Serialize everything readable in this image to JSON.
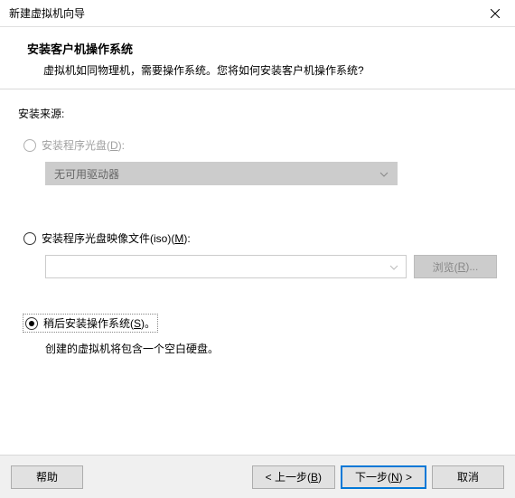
{
  "window": {
    "title": "新建虚拟机向导"
  },
  "header": {
    "title": "安装客户机操作系统",
    "desc": "虚拟机如同物理机，需要操作系统。您将如何安装客户机操作系统?"
  },
  "source_label": "安装来源:",
  "options": {
    "disc": {
      "label_pre": "安装程序光盘(",
      "hotkey": "D",
      "label_post": "):",
      "dropdown_text": "无可用驱动器",
      "enabled": false,
      "selected": false
    },
    "iso": {
      "label_pre": "安装程序光盘映像文件(iso)(",
      "hotkey": "M",
      "label_post": "):",
      "browse_pre": "浏览(",
      "browse_hotkey": "R",
      "browse_post": ")...",
      "input_value": "",
      "enabled": true,
      "selected": false
    },
    "later": {
      "label_pre": "稍后安装操作系统(",
      "hotkey": "S",
      "label_post": ")。",
      "hint": "创建的虚拟机将包含一个空白硬盘。",
      "enabled": true,
      "selected": true
    }
  },
  "footer": {
    "help": "帮助",
    "back_pre": "< 上一步(",
    "back_hotkey": "B",
    "back_post": ")",
    "next_pre": "下一步(",
    "next_hotkey": "N",
    "next_post": ") >",
    "cancel": "取消"
  }
}
